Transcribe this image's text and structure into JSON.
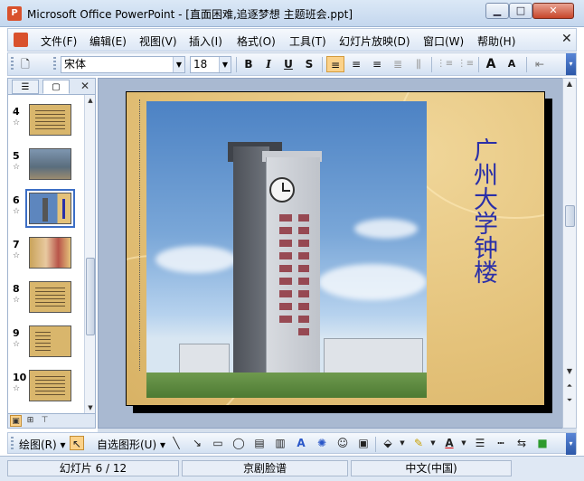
{
  "window": {
    "title": "Microsoft Office PowerPoint - [直面困难,追逐梦想 主题班会.ppt]",
    "app_icon": "powerpoint-icon",
    "minimize_label": "▁",
    "maximize_label": "□",
    "close_label": "✕"
  },
  "menu": {
    "items": [
      "文件(F)",
      "编辑(E)",
      "视图(V)",
      "插入(I)",
      "格式(O)",
      "工具(T)",
      "幻灯片放映(D)",
      "窗口(W)",
      "帮助(H)"
    ],
    "close_label": "✕"
  },
  "toolbar": {
    "new_label": "🗋",
    "font_name": "宋体",
    "font_size": "18",
    "bold": "B",
    "italic": "I",
    "underline": "U",
    "shadow": "S",
    "align_left": "≡",
    "align_center": "≡",
    "align_right": "≡",
    "distribute": "≣",
    "numbering": "⋮≡",
    "bullets": "⋮≡",
    "grow_font": "A",
    "shrink_font": "A",
    "indent": "⇤",
    "more": "▾"
  },
  "left_pane": {
    "tab_outline": "☰",
    "tab_slides": "▢",
    "close_label": "✕",
    "thumbnails": [
      {
        "number": "4",
        "star": "☆"
      },
      {
        "number": "5",
        "star": "☆"
      },
      {
        "number": "6",
        "star": "☆"
      },
      {
        "number": "7",
        "star": "☆"
      },
      {
        "number": "8",
        "star": "☆"
      },
      {
        "number": "9",
        "star": "☆"
      },
      {
        "number": "10",
        "star": "☆"
      }
    ],
    "selected_slide": "6"
  },
  "slide": {
    "title": "广州大学钟楼"
  },
  "drawing_toolbar": {
    "draw_label": "绘图(R)",
    "autoshapes_label": "自选图形(U)"
  },
  "status": {
    "slide_position": "幻灯片 6 / 12",
    "design": "京剧脸谱",
    "language": "中文(中国)"
  },
  "colors": {
    "title_text": "#2a2fa8",
    "slide_background": "#e4c27a",
    "active_button": "#fbd28a"
  }
}
